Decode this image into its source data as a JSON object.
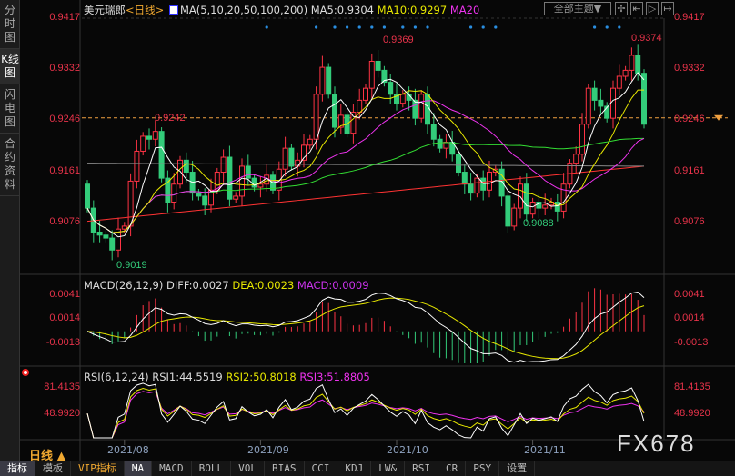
{
  "sidebar": {
    "tabs": [
      {
        "label": "分时图"
      },
      {
        "label": "K线图",
        "active": true
      },
      {
        "label": "闪电图"
      },
      {
        "label": "合约资料"
      }
    ]
  },
  "header": {
    "symbol": "美元瑞郎",
    "period": "<日线>",
    "ma_title": "MA(5,10,20,50,100,200)",
    "ma5": "MA5:0.9304",
    "ma10": "MA10:0.9297",
    "ma20": "MA20",
    "theme": "全部主题▼"
  },
  "macd": {
    "title": "MACD(26,12,9)",
    "diff": "DIFF:0.0027",
    "dea": "DEA:0.0023",
    "macd": "MACD:0.0009",
    "ticks": [
      "0.0041",
      "0.0014",
      "-0.0013"
    ]
  },
  "rsi": {
    "title": "RSI(6,12,24)",
    "rsi1": "RSI1:44.5519",
    "rsi2": "RSI2:50.8018",
    "rsi3": "RSI3:51.8805",
    "ticks": [
      "81.4135",
      "48.9920"
    ]
  },
  "footer": {
    "period": "日线 ▲",
    "watermark": "FX678",
    "toolbar": [
      "指标",
      "模板",
      "VIP指标",
      "MA",
      "MACD",
      "BOLL",
      "VOL",
      "BIAS",
      "CCI",
      "KDJ",
      "LW&",
      "RSI",
      "CR",
      "PSY",
      "设置"
    ]
  },
  "colors": {
    "up": "#ff3344",
    "down": "#33cc7a",
    "ma5": "#ffffff",
    "ma10": "#e8e800",
    "ma20": "#ee33ee",
    "ma50": "#33dd33",
    "ma100": "#888888",
    "ma200": "#ff3333"
  },
  "chart_data": {
    "type": "candlestick",
    "title": "美元瑞郎 日线",
    "x_ticks": [
      "2021/08",
      "2021/09",
      "2021/10",
      "2021/11"
    ],
    "x_tick_index": [
      6,
      28,
      50,
      72
    ],
    "y_ticks": [
      "0.9417",
      "0.9332",
      "0.9246",
      "0.9161",
      "0.9076"
    ],
    "ylim": [
      0.895,
      0.9417
    ],
    "annotations": [
      {
        "text": "0.9019",
        "index": 5,
        "kind": "low"
      },
      {
        "text": "0.9242",
        "index": 9,
        "kind": "high"
      },
      {
        "text": "0.9369",
        "index": 46,
        "kind": "high"
      },
      {
        "text": "0.9088",
        "index": 65,
        "kind": "low"
      },
      {
        "text": "0.9374",
        "index": 88,
        "kind": "high"
      }
    ],
    "current_price": 0.9246,
    "signal_dots": [
      29,
      37,
      40,
      42,
      44,
      46,
      48,
      51,
      53,
      55,
      62,
      64,
      66,
      82,
      84,
      86
    ],
    "close": [
      0.91,
      0.906,
      0.9055,
      0.905,
      0.903,
      0.9065,
      0.907,
      0.9145,
      0.9195,
      0.922,
      0.9215,
      0.9228,
      0.915,
      0.911,
      0.914,
      0.918,
      0.916,
      0.9125,
      0.912,
      0.9105,
      0.913,
      0.916,
      0.9185,
      0.9115,
      0.912,
      0.917,
      0.915,
      0.9135,
      0.914,
      0.9155,
      0.913,
      0.9165,
      0.92,
      0.917,
      0.918,
      0.9205,
      0.9215,
      0.929,
      0.9335,
      0.929,
      0.9235,
      0.9255,
      0.9225,
      0.926,
      0.928,
      0.93,
      0.9345,
      0.933,
      0.931,
      0.929,
      0.9275,
      0.929,
      0.928,
      0.925,
      0.929,
      0.924,
      0.9215,
      0.92,
      0.921,
      0.919,
      0.916,
      0.914,
      0.9125,
      0.915,
      0.913,
      0.916,
      0.9165,
      0.912,
      0.907,
      0.91,
      0.914,
      0.909,
      0.911,
      0.91,
      0.9105,
      0.911,
      0.9095,
      0.914,
      0.9175,
      0.919,
      0.924,
      0.93,
      0.928,
      0.927,
      0.925,
      0.93,
      0.932,
      0.933,
      0.9355,
      0.9325,
      0.924
    ],
    "ma100_ends": [
      0.9175,
      0.917
    ],
    "ma200_ends": [
      0.9078,
      0.917
    ]
  }
}
